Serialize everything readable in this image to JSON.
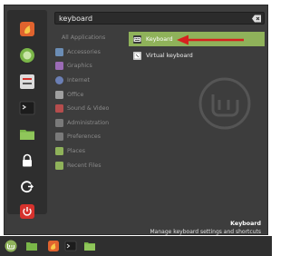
{
  "search": {
    "query": "keyboard"
  },
  "categories": [
    {
      "label": "All Applications",
      "icon": "none",
      "color": ""
    },
    {
      "label": "Accessories",
      "icon": "accessories-icon",
      "color": "#6b8db5"
    },
    {
      "label": "Graphics",
      "icon": "graphics-icon",
      "color": "#9b6bb5"
    },
    {
      "label": "Internet",
      "icon": "internet-icon",
      "color": "#6b7fb5"
    },
    {
      "label": "Office",
      "icon": "office-icon",
      "color": "#a0a0a0"
    },
    {
      "label": "Sound & Video",
      "icon": "sound-video-icon",
      "color": "#b54d4d"
    },
    {
      "label": "Administration",
      "icon": "administration-icon",
      "color": "#7a7a7a"
    },
    {
      "label": "Preferences",
      "icon": "preferences-icon",
      "color": "#7a7a7a"
    },
    {
      "label": "Places",
      "icon": "places-icon",
      "color": "#8fb25a"
    },
    {
      "label": "Recent Files",
      "icon": "recent-files-icon",
      "color": "#8fb25a"
    }
  ],
  "results": [
    {
      "label": "Keyboard",
      "icon": "keyboard-icon",
      "selected": true
    },
    {
      "label": "Virtual keyboard",
      "icon": "virtual-keyboard-icon",
      "selected": false
    }
  ],
  "description": {
    "title": "Keyboard",
    "text": "Manage keyboard settings and shortcuts"
  },
  "favorites": [
    {
      "icon": "firefox-icon",
      "color": "#e0632e"
    },
    {
      "icon": "software-manager-icon",
      "color": "#7ab648"
    },
    {
      "icon": "settings-icon",
      "color": "#dcdcdc"
    },
    {
      "icon": "terminal-icon",
      "color": "#1c1c1c"
    },
    {
      "icon": "files-icon",
      "color": "#7ab648"
    },
    {
      "icon": "lock-screen-icon",
      "color": "#ffffff"
    },
    {
      "icon": "logout-icon",
      "color": "#ffffff"
    },
    {
      "icon": "power-icon",
      "color": "#d6322d"
    }
  ],
  "colors": {
    "accent": "#8fb25a",
    "annotation": "#d6211f"
  }
}
